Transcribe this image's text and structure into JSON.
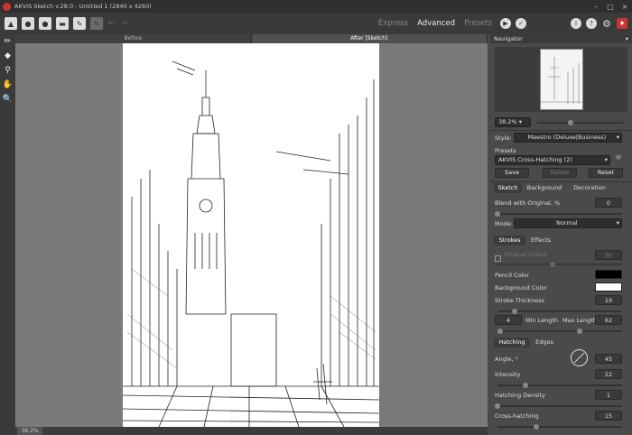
{
  "window": {
    "title": "AKVIS Sketch v.28.0 - Untitled 1 (2840 x 4260)",
    "minimize": "–",
    "maximize": "□",
    "close": "×"
  },
  "toolbar": {
    "modes": [
      "Express",
      "Advanced",
      "Presets"
    ],
    "active_mode": "Advanced"
  },
  "view_tabs": [
    "Before",
    "After [Sketch]"
  ],
  "status": {
    "zoom": "38.2%"
  },
  "navigator": {
    "title": "Navigator",
    "zoom": "38.2% ▾"
  },
  "settings": {
    "style_label": "Style:",
    "style_value": "Maestro (Deluxe|Business)",
    "presets_label": "Presets",
    "preset_value": "AKVIS Cross-Hatching (2)",
    "save": "Save",
    "delete": "Delete",
    "reset": "Reset",
    "tabs": [
      "Sketch",
      "Background",
      "Decoration"
    ],
    "blend_label": "Blend with Original, %",
    "blend_value": "0",
    "mode_label": "Mode:",
    "mode_value": "Normal",
    "subtabs": [
      "Strokes",
      "Effects"
    ],
    "original_colors": "Original Colors",
    "original_colors_value": "50",
    "pencil_color_label": "Pencil Color",
    "pencil_color": "#000000",
    "bg_color_label": "Background Color",
    "bg_color": "#ffffff",
    "stroke_thickness_label": "Stroke Thickness",
    "stroke_thickness": "19",
    "min_length_value": "4",
    "min_length_label": "Min Length",
    "max_length_label": "Max Length",
    "max_length_value": "62",
    "hatch_tabs": [
      "Hatching",
      "Edges"
    ],
    "angle_label": "Angle, °",
    "angle_value": "45",
    "intensity_label": "Intensity",
    "intensity_value": "22",
    "density_label": "Hatching Density",
    "density_value": "1",
    "cross_label": "Cross-hatching",
    "cross_value": "15"
  }
}
